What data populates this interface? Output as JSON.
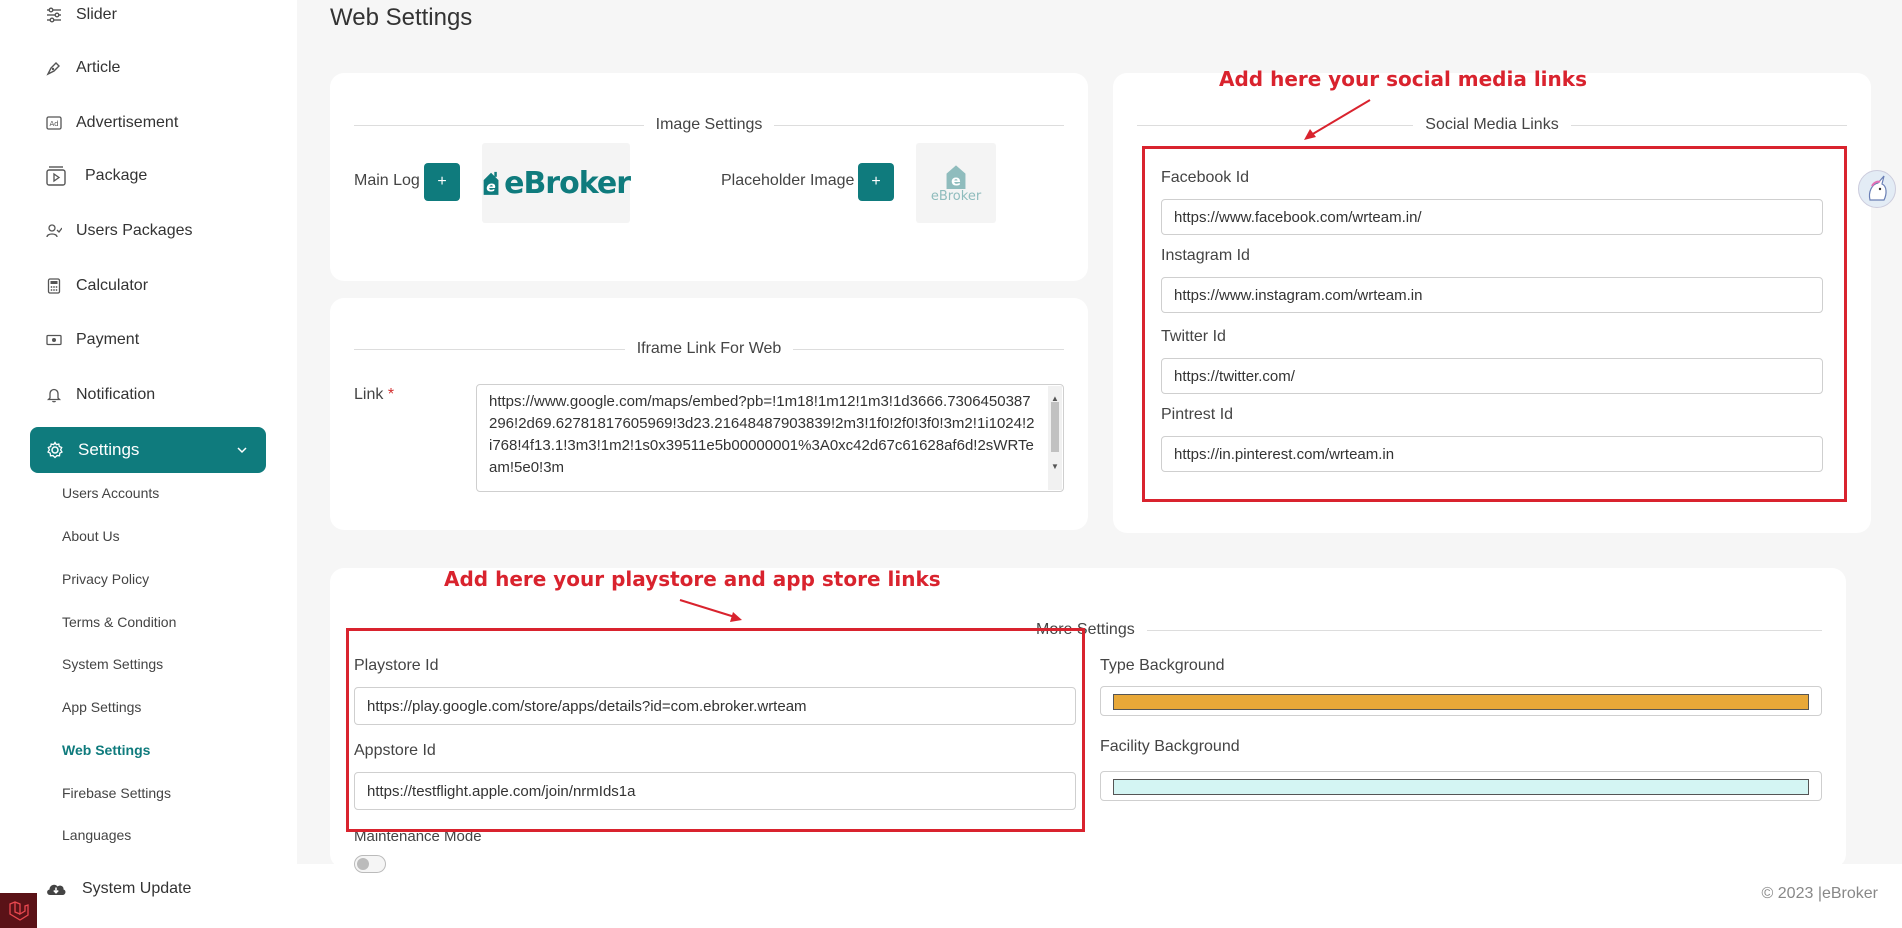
{
  "sidebar": {
    "items": [
      {
        "label": "Slider",
        "icon": "sliders-icon"
      },
      {
        "label": "Article",
        "icon": "pen-icon"
      },
      {
        "label": "Advertisement",
        "icon": "ad-icon"
      },
      {
        "label": "Package",
        "icon": "package-icon"
      },
      {
        "label": "Users Packages",
        "icon": "user-check-icon"
      },
      {
        "label": "Calculator",
        "icon": "calculator-icon"
      },
      {
        "label": "Payment",
        "icon": "payment-icon"
      },
      {
        "label": "Notification",
        "icon": "bell-icon"
      }
    ],
    "settings": {
      "label": "Settings",
      "icon": "gear-icon"
    },
    "sub_items": [
      {
        "label": "Users Accounts"
      },
      {
        "label": "About Us"
      },
      {
        "label": "Privacy Policy"
      },
      {
        "label": "Terms & Condition"
      },
      {
        "label": "System Settings"
      },
      {
        "label": "App Settings"
      },
      {
        "label": "Web Settings"
      },
      {
        "label": "Firebase Settings"
      },
      {
        "label": "Languages"
      }
    ],
    "system_update": "System Update"
  },
  "page": {
    "title": "Web Settings"
  },
  "image_settings": {
    "legend": "Image Settings",
    "main_logo_label": "Main Log",
    "placeholder_label": "Placeholder Image",
    "add_symbol": "+",
    "logo_text": "eBroker",
    "logo_letter": "e"
  },
  "iframe": {
    "legend": "Iframe Link For Web",
    "link_label": "Link",
    "required_mark": "*",
    "value": "https://www.google.com/maps/embed?pb=!1m18!1m12!1m3!1d3666.7306450387296!2d69.62781817605969!3d23.21648487903839!2m3!1f0!2f0!3f0!3m2!1i1024!2i768!4f13.1!3m3!1m2!1s0x39511e5b00000001%3A0xc42d67c61628af6d!2sWRTeam!5e0!3m"
  },
  "social": {
    "legend": "Social Media Links",
    "annotation": "Add here your social media links",
    "fields": [
      {
        "label": "Facebook Id",
        "value": "https://www.facebook.com/wrteam.in/"
      },
      {
        "label": "Instagram Id",
        "value": "https://www.instagram.com/wrteam.in"
      },
      {
        "label": "Twitter Id",
        "value": "https://twitter.com/"
      },
      {
        "label": "Pintrest Id",
        "value": "https://in.pinterest.com/wrteam.in"
      }
    ]
  },
  "more": {
    "legend": "More Settings",
    "annotation": "Add here your playstore and app store links",
    "playstore_label": "Playstore Id",
    "playstore_value": "https://play.google.com/store/apps/details?id=com.ebroker.wrteam",
    "appstore_label": "Appstore Id",
    "appstore_value": "https://testflight.apple.com/join/nrmIds1a",
    "type_bg_label": "Type Background",
    "type_bg_color": "#e8a838",
    "facility_bg_label": "Facility Background",
    "facility_bg_color": "#d4f5f3",
    "maintenance_label": "Maintenance Mode",
    "maintenance_on": false
  },
  "footer": {
    "copyright": "© 2023 |eBroker"
  },
  "colors": {
    "accent": "#0f7b7d",
    "annotation": "#d9232e"
  }
}
